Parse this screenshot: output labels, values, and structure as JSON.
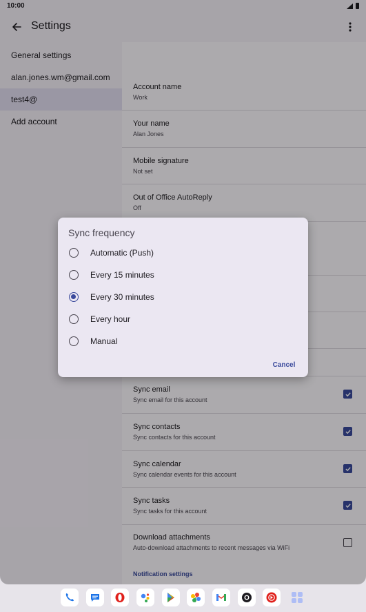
{
  "statusbar": {
    "time": "10:00"
  },
  "appbar": {
    "title": "Settings"
  },
  "sidebar": {
    "items": [
      {
        "label": "General settings"
      },
      {
        "label": "alan.jones.wm@gmail.com"
      },
      {
        "label": "test4@"
      },
      {
        "label": "Add account"
      }
    ]
  },
  "settings": {
    "account_name": {
      "title": "Account name",
      "value": "Work"
    },
    "your_name": {
      "title": "Your name",
      "value": "Alan Jones"
    },
    "signature": {
      "title": "Mobile signature",
      "value": "Not set"
    },
    "ooo": {
      "title": "Out of Office AutoReply",
      "value": "Off"
    },
    "sync_email": {
      "title": "Sync email",
      "desc": "Sync email for this account",
      "checked": true
    },
    "sync_contacts": {
      "title": "Sync contacts",
      "desc": "Sync contacts for this account",
      "checked": true
    },
    "sync_calendar": {
      "title": "Sync calendar",
      "desc": "Sync calendar events for this account",
      "checked": true
    },
    "sync_tasks": {
      "title": "Sync tasks",
      "desc": "Sync tasks for this account",
      "checked": true
    },
    "download_attachments": {
      "title": "Download attachments",
      "desc": "Auto-download attachments to recent messages via WiFi",
      "checked": false
    },
    "notification_header": "Notification settings"
  },
  "dialog": {
    "title": "Sync frequency",
    "options": [
      {
        "label": "Automatic (Push)",
        "selected": false
      },
      {
        "label": "Every 15 minutes",
        "selected": false
      },
      {
        "label": "Every 30 minutes",
        "selected": true
      },
      {
        "label": "Every hour",
        "selected": false
      },
      {
        "label": "Manual",
        "selected": false
      }
    ],
    "cancel_label": "Cancel"
  },
  "dock": {
    "apps": [
      "phone-icon",
      "messages-icon",
      "opera-icon",
      "assistant-icon",
      "play-store-icon",
      "photos-icon",
      "gmail-icon",
      "camera-icon",
      "youtube-music-icon",
      "app-drawer-icon"
    ]
  },
  "colors": {
    "accent": "#3a4a9c",
    "surface": "#fefbff",
    "dialog": "#ebe7f2"
  }
}
